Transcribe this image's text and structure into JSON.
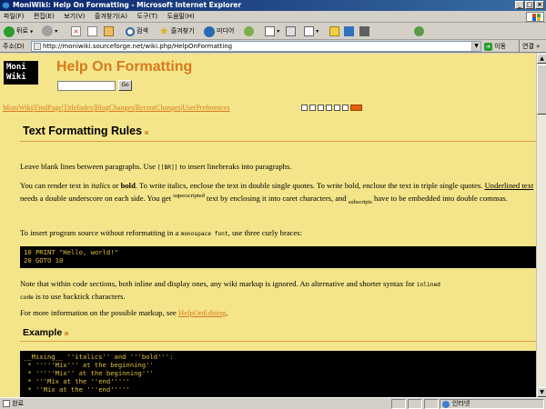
{
  "window": {
    "title": "MoniWiki: Help On Formatting - Microsoft Internet Explorer",
    "minimize": "_",
    "maximize": "□",
    "close": "×"
  },
  "menu": [
    "파일(F)",
    "편집(E)",
    "보기(V)",
    "즐겨찾기(A)",
    "도구(T)",
    "도움말(H)"
  ],
  "toolbar": {
    "back_label": "뒤로",
    "search_label": "검색",
    "favorites_label": "즐겨찾기",
    "media_label": "미디어"
  },
  "address": {
    "label": "주소(D)",
    "url": "http://moniwiki.sourceforge.net/wiki.php/HelpOnFormatting",
    "go_label": "이동",
    "links_label": "연결"
  },
  "page": {
    "logo_line1": "Moni",
    "logo_line2": "Wiki",
    "title": "Help On Formatting",
    "go_button": "Go",
    "nav_links": [
      "MoniWiki",
      "FindPage",
      "TitleIndex",
      "BlogChanges",
      "RecentChanges",
      "UserPreferences"
    ],
    "nav_sep": "|",
    "section1_heading": "Text Formatting Rules",
    "p1_a": "Leave blank lines between paragraphs. Use ",
    "p1_code": "[[BR]]",
    "p1_b": " to insert linebreaks into paragraphs.",
    "p2_a": "You can render text in ",
    "p2_italics": "italics",
    "p2_b": " or ",
    "p2_bold": "bold",
    "p2_c": ". To write italics, enclose the text in double single quotes. To write bold, enclose the text in triple single quotes. ",
    "p2_underlined": "Underlined text",
    "p2_d": " needs a double underscore on each side. You get ",
    "p2_sup": "superscripted",
    "p2_e": " text by enclosing it into caret characters, and ",
    "p2_sub": "subscripts",
    "p2_f": " have to be embedded into double commas.",
    "p3_a": "To insert program source without reformatting in a ",
    "p3_code": "monospace font",
    "p3_b": ", use three curly braces:",
    "code1": "10 PRINT \"Hello, world!\"\n20 GOTO 10",
    "p4_a": "Note that within code sections, both inline and display ones, any wiki markup is ignored. An alternative and shorter syntax for ",
    "p4_code1": "inlined",
    "p4_code2": "code",
    "p4_b": " is to use backtick characters.",
    "p5_a": "For more information on the possible markup, see ",
    "p5_link": "HelpOnEditing",
    "p5_b": ".",
    "section2_heading": "Example",
    "code2": "__Mixing__ ''italics'' and '''bold''':\n * '''''Mix''' at the beginning''\n * '''''Mix'' at the beginning'''\n * '''Mix at the ''end'''''\n * ''Mix at the '''end'''''"
  },
  "status": {
    "left": "완료",
    "zone": "인터넷"
  },
  "colors": {
    "page_bg": "#f4e58a",
    "title_orange": "#d87a1e",
    "code_bg": "#000000",
    "code_fg": "#e0c040"
  }
}
